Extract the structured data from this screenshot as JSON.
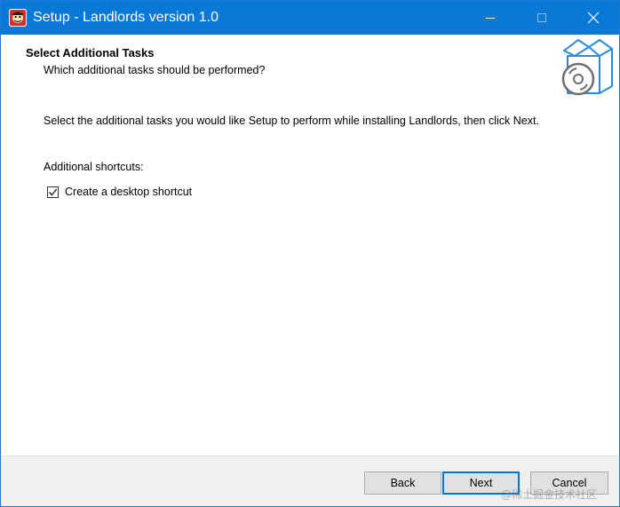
{
  "window": {
    "title": "Setup - Landlords version 1.0",
    "accent_color": "#0a78d7",
    "app_icon": "landlords-app-icon",
    "controls": {
      "minimize_icon": "minimize-icon",
      "maximize_icon": "maximize-icon",
      "close_icon": "close-icon"
    }
  },
  "header": {
    "title": "Select Additional Tasks",
    "subtitle": "Which additional tasks should be performed?",
    "icon": "setup-box-disc-icon"
  },
  "body": {
    "instructions": "Select the additional tasks you would like Setup to perform while installing Landlords, then click Next.",
    "group_label": "Additional shortcuts:",
    "tasks": [
      {
        "label": "Create a desktop shortcut",
        "checked": true
      }
    ]
  },
  "footer": {
    "back_label": "Back",
    "next_label": "Next",
    "cancel_label": "Cancel",
    "default_button_color": "#0078d7"
  },
  "watermark": "@稀土掘金技术社区"
}
